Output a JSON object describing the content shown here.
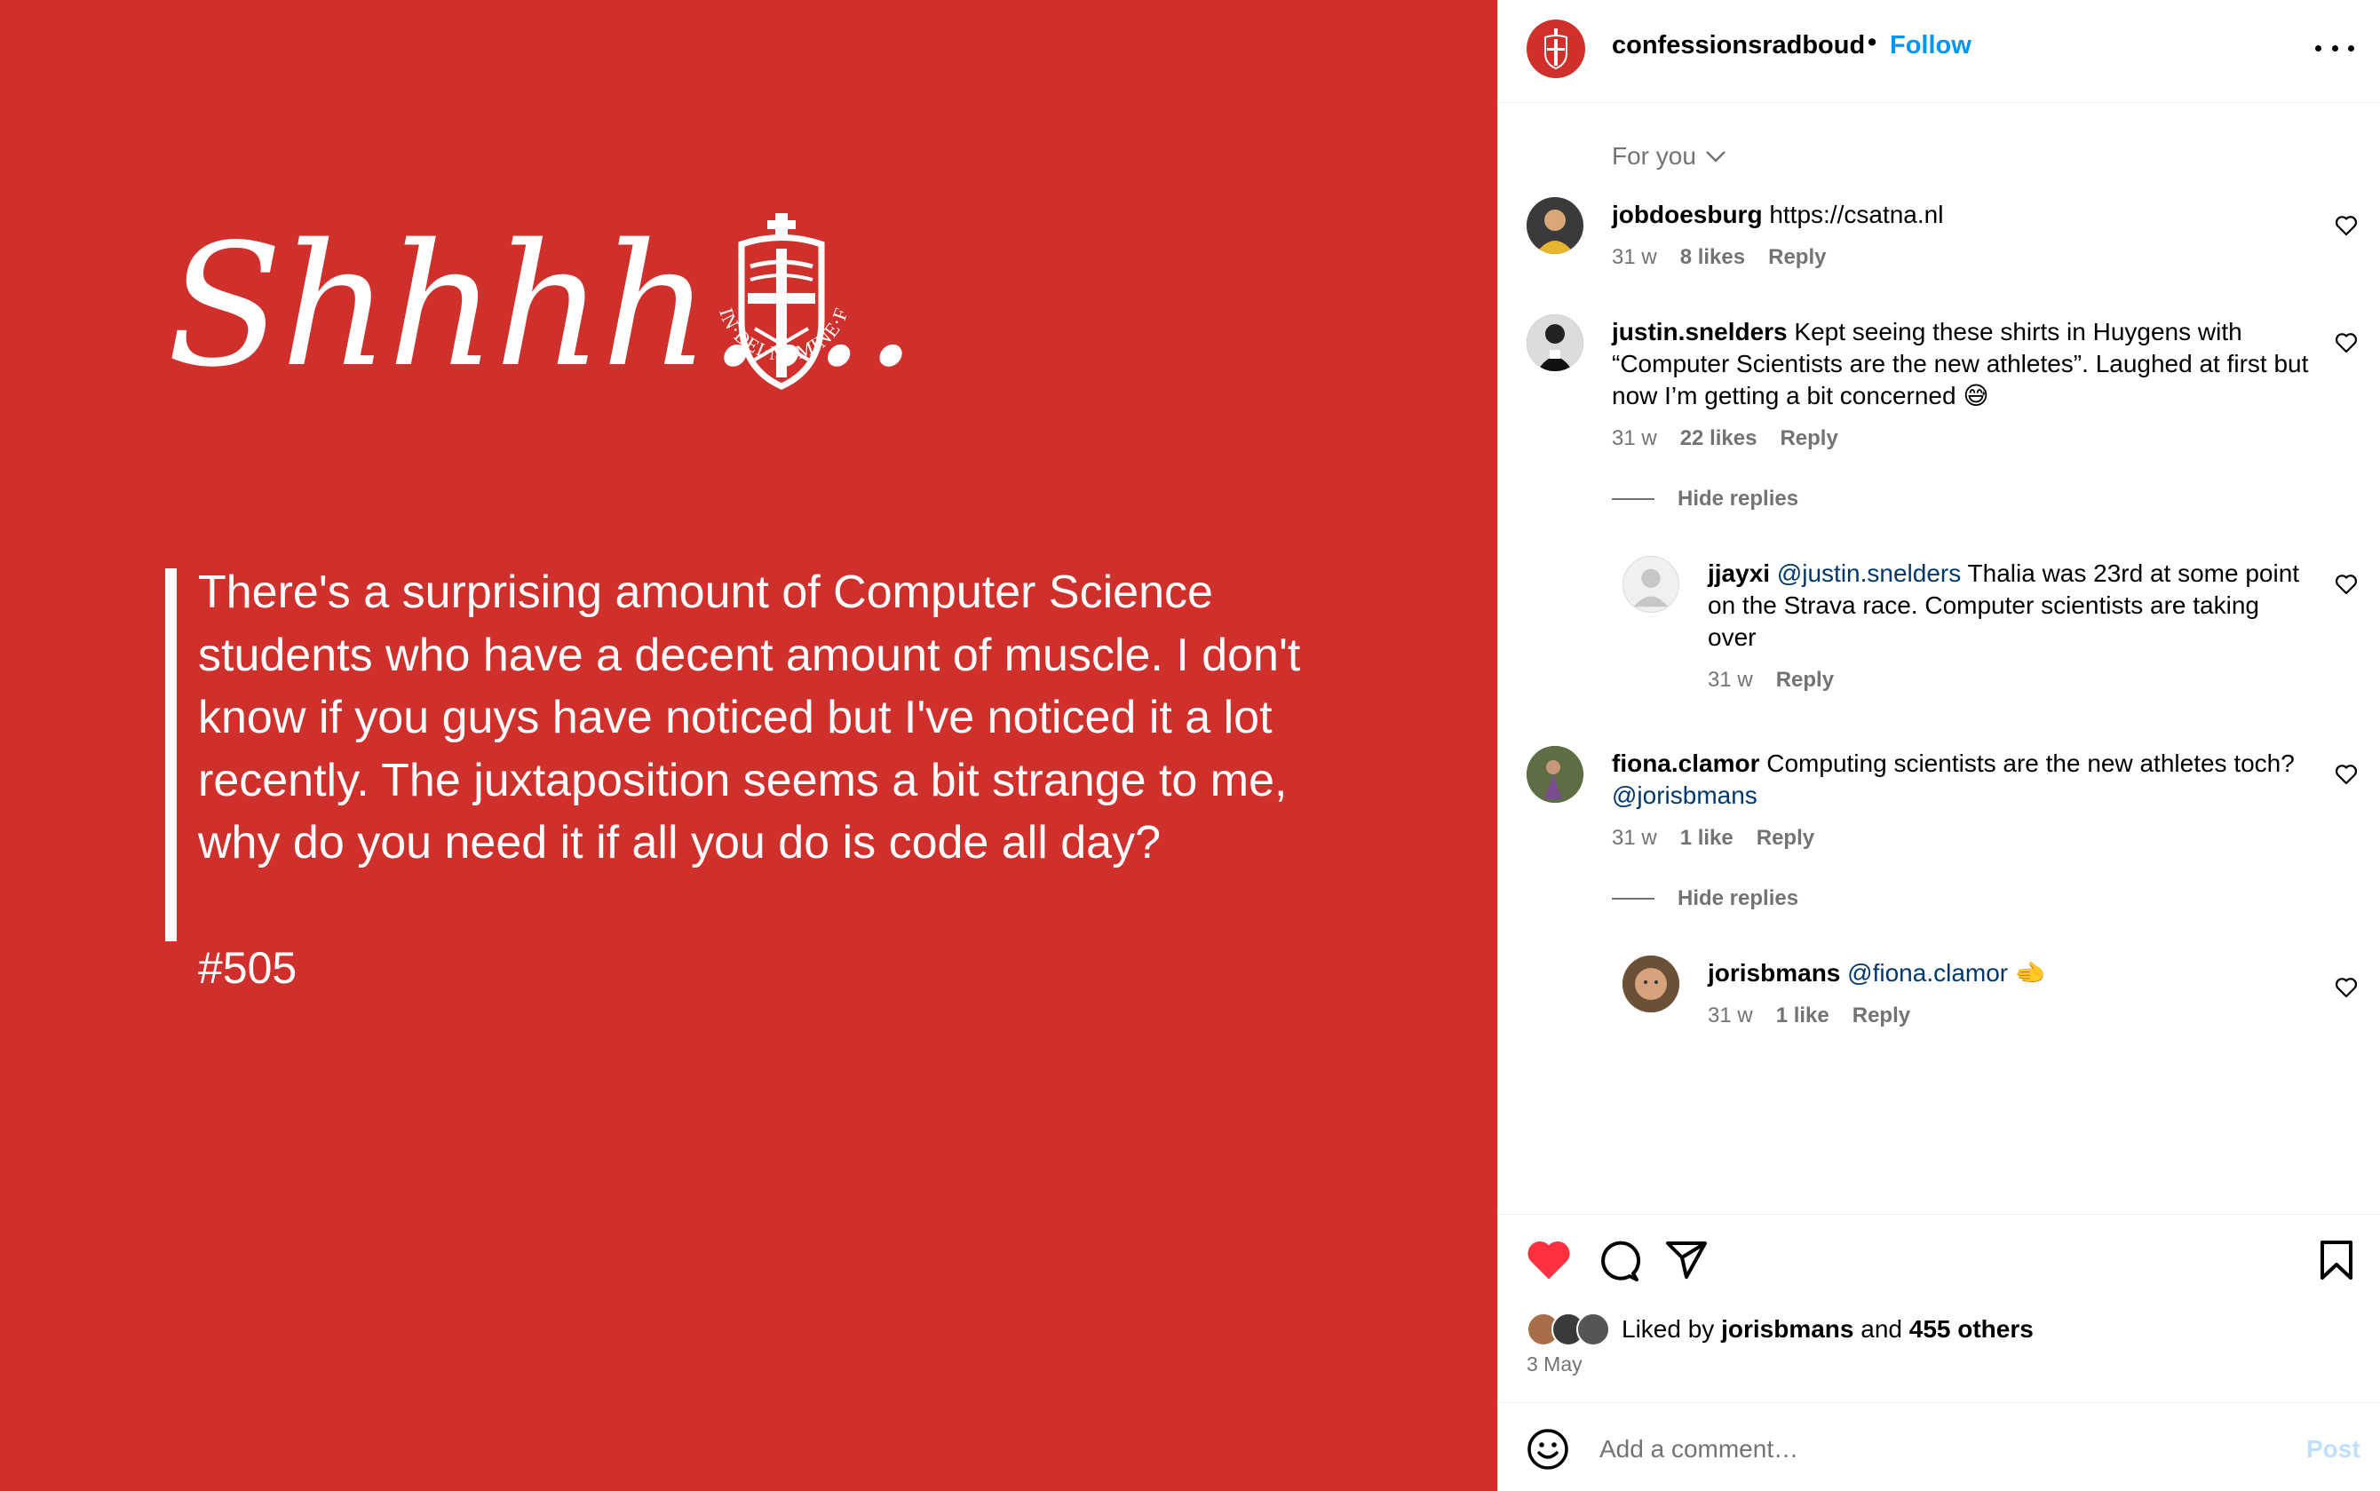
{
  "post": {
    "headline": "Shhhh....",
    "seal_motto": "IN·DEI·NOMINE·FELICITER",
    "quote": "There's a surprising amount of Computer Science students who have a decent amount of muscle. I don't know if you guys have noticed but I've noticed it a lot recently. The juxtaposition seems a bit strange to me, why do you need it if all you do is code all day?",
    "number": "#505",
    "background_color": "#d0302b"
  },
  "header": {
    "username": "confessionsradboud",
    "separator": "•",
    "follow_label": "Follow"
  },
  "sort": {
    "label": "For you"
  },
  "comments": [
    {
      "user": "jobdoesburg",
      "text": "https://csatna.nl",
      "time": "31 w",
      "likes": "8 likes",
      "reply": "Reply"
    },
    {
      "user": "justin.snelders",
      "text": "Kept seeing these shirts in Huygens with “Computer Scientists are the new athletes”. Laughed at first but now I’m getting a bit concerned",
      "emoji": "😅",
      "time": "31 w",
      "likes": "22 likes",
      "reply": "Reply",
      "hide_replies": "Hide replies",
      "replies": [
        {
          "user": "jjayxi",
          "mention": "@justin.snelders",
          "text": "Thalia was 23rd at some point on the Strava race. Computer scientists are taking over",
          "time": "31 w",
          "reply": "Reply"
        }
      ]
    },
    {
      "user": "fiona.clamor",
      "text": "Computing scientists are the new athletes toch?",
      "mention": "@jorisbmans",
      "time": "31 w",
      "likes": "1 like",
      "reply": "Reply",
      "hide_replies": "Hide replies",
      "replies": [
        {
          "user": "jorisbmans",
          "mention": "@fiona.clamor",
          "emoji": "🫲",
          "time": "31 w",
          "likes": "1 like",
          "reply": "Reply"
        }
      ]
    }
  ],
  "likes": {
    "prefix": "Liked by",
    "user": "jorisbmans",
    "middle": "and",
    "others": "455 others",
    "date": "3 May"
  },
  "composer": {
    "placeholder": "Add a comment…",
    "post_label": "Post"
  },
  "icons": {
    "like": "heart-filled-icon",
    "comment": "comment-bubble-icon",
    "share": "paper-plane-icon",
    "save": "bookmark-icon",
    "emoji": "smiley-icon",
    "more": "more-horizontal-icon"
  },
  "colors": {
    "accent": "#0095f6",
    "like_red": "#ff3040",
    "mention": "#00376b",
    "muted": "#737373"
  }
}
